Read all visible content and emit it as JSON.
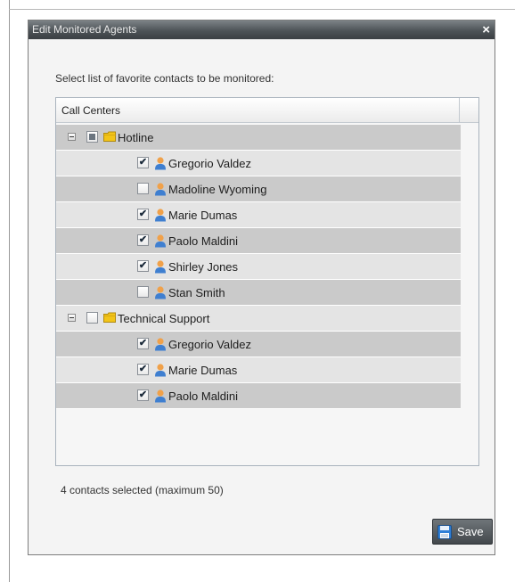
{
  "dialog": {
    "title": "Edit Monitored Agents",
    "close_glyph": "×",
    "instruction": "Select list of favorite contacts to be monitored:",
    "tree_header": "Call Centers",
    "status": "4 contacts selected (maximum 50)",
    "save_label": "Save"
  },
  "groups": [
    {
      "name": "Hotline",
      "state": "partial",
      "agents": [
        {
          "name": "Gregorio Valdez",
          "checked": true
        },
        {
          "name": "Madoline Wyoming",
          "checked": false
        },
        {
          "name": "Marie Dumas",
          "checked": true
        },
        {
          "name": "Paolo Maldini",
          "checked": true
        },
        {
          "name": "Shirley Jones",
          "checked": true
        },
        {
          "name": "Stan Smith",
          "checked": false
        }
      ]
    },
    {
      "name": "Technical Support",
      "state": "unchecked",
      "agents": [
        {
          "name": "Gregorio Valdez",
          "checked": true
        },
        {
          "name": "Marie Dumas",
          "checked": true
        },
        {
          "name": "Paolo Maldini",
          "checked": true
        }
      ]
    }
  ],
  "icons": {
    "check": "✔",
    "folder": "folder-icon",
    "person": "person-icon",
    "save": "floppy-disk-icon"
  },
  "colors": {
    "title_bar": "#4d5357",
    "row_dark": "#cacaca",
    "row_light": "#e4e4e4",
    "folder": "#f2c418",
    "person_body": "#3f7fd0",
    "person_head": "#f0a14a"
  }
}
